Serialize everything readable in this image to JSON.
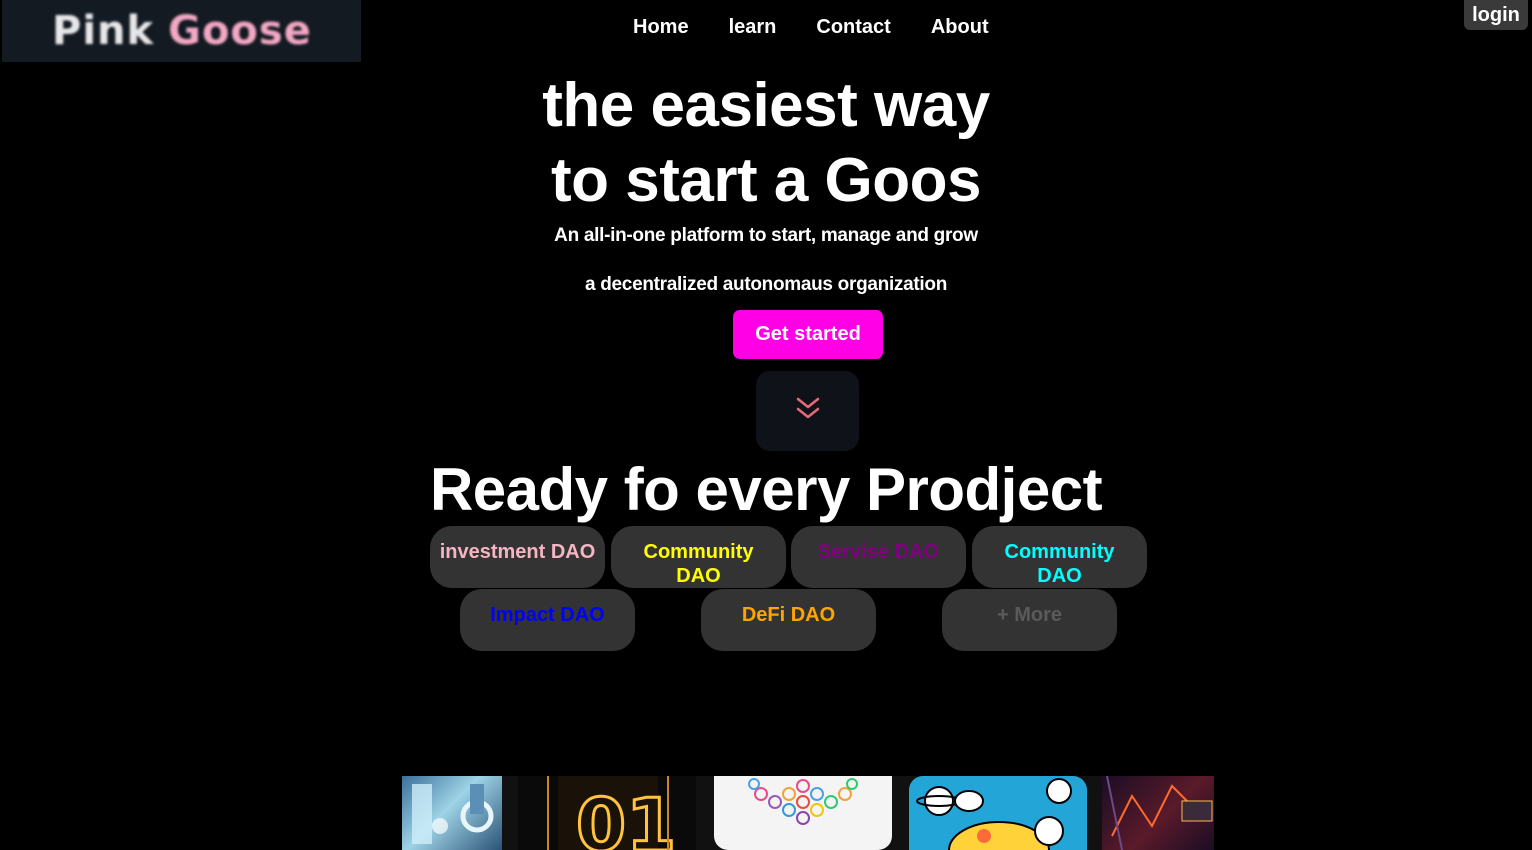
{
  "brand": {
    "word1": "Pink",
    "word2": "Goose"
  },
  "nav": {
    "items": [
      "Home",
      "learn",
      "Contact",
      "About"
    ],
    "login_label": "login"
  },
  "hero": {
    "title_line1": "the easiest way",
    "title_line2": "to start a Goos",
    "subtitle_line1": "An all-in-one platform to start, manage and grow",
    "subtitle_line2": "a decentralized autonomaus organization",
    "cta_label": "Get started",
    "scroll_icon": "double-chevron-down-icon"
  },
  "projects": {
    "title": "Ready fo every Prodject",
    "chips": [
      {
        "label": "investment DAO",
        "color": "#f4b6c2"
      },
      {
        "label": "Community DAO",
        "color": "#ffff00"
      },
      {
        "label": "Servise DAO",
        "color": "#800080"
      },
      {
        "label": "Community DAO",
        "color": "#00ffff"
      },
      {
        "label": "Impact DAO",
        "color": "#0000ff"
      },
      {
        "label": "DeFi DAO",
        "color": "#ffa500"
      },
      {
        "label": "+ More",
        "color": "#5a5a5a"
      }
    ]
  },
  "colors": {
    "accent": "#ff00e6",
    "chip_bg": "#333333",
    "scroll_arrow": "#e86a7a"
  }
}
